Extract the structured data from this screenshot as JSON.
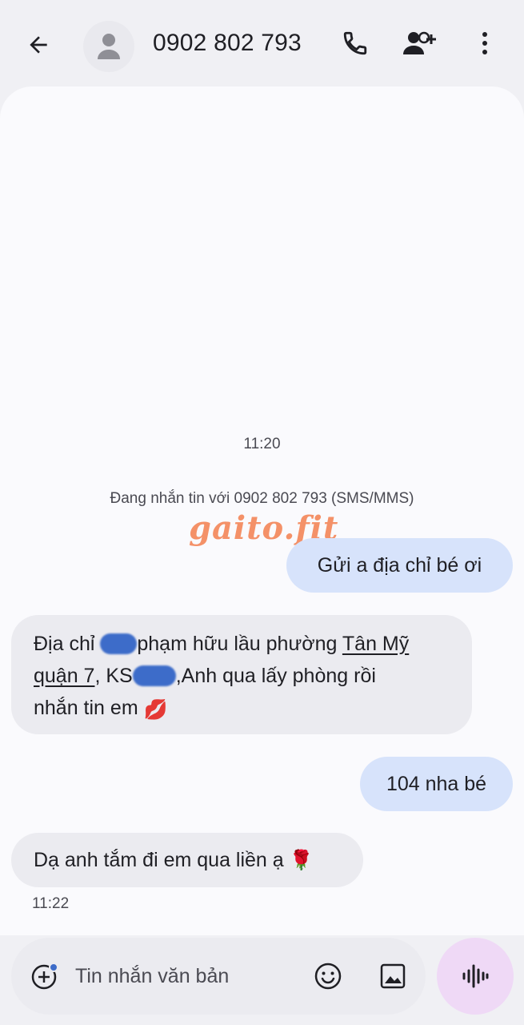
{
  "header": {
    "contact_name": "0902 802 793",
    "icons": {
      "back": "arrow-back-icon",
      "avatar": "person-icon",
      "call": "phone-icon",
      "add_contact": "add-person-icon",
      "more": "more-vert-icon"
    }
  },
  "conversation": {
    "timestamp_top": "11:20",
    "info_line": "Đang nhắn tin với 0902 802 793 (SMS/MMS)",
    "watermark": "gaito.fit",
    "messages": [
      {
        "direction": "outgoing",
        "text": "Gửi a địa chỉ bé ơi"
      },
      {
        "direction": "incoming",
        "part1": "Địa chỉ ",
        "part2": "phạm hữu lầu phường ",
        "link1": "Tân Mỹ",
        "link2": "quận 7",
        "part3": ", KS",
        "part4": ",Anh qua lấy phòng rồi",
        "part5": "nhắn tin em",
        "emoji": "💋"
      },
      {
        "direction": "outgoing",
        "text": "104 nha bé"
      },
      {
        "direction": "incoming",
        "text": "Dạ anh tắm đi em qua liền ạ",
        "emoji": "🌹"
      }
    ],
    "timestamp_bottom": "11:22"
  },
  "compose": {
    "placeholder": "Tin nhắn văn bản",
    "icons": {
      "add": "add-circle-icon",
      "emoji": "emoji-icon",
      "gallery": "image-icon",
      "voice": "voice-waveform-icon"
    }
  },
  "colors": {
    "background": "#f0f0f4",
    "conversation_bg": "#fafafd",
    "outgoing_bubble": "#d7e3fb",
    "incoming_bubble": "#ebebf0",
    "voice_button": "#efd9f6",
    "redaction": "#3d6cc9",
    "watermark": "#f47f4f"
  }
}
